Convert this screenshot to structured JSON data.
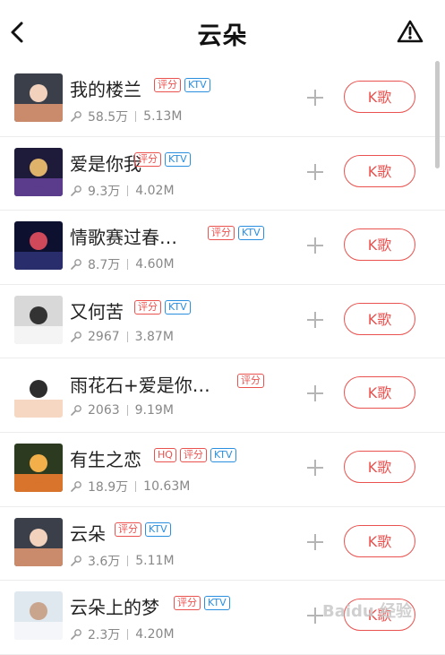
{
  "header": {
    "title": "云朵",
    "back_icon": "chevron-left-icon",
    "report_icon": "warning-triangle-icon"
  },
  "buttons": {
    "sing_label": "K歌"
  },
  "songs": [
    {
      "title": "我的楼兰",
      "tags": [
        "评分",
        "KTV"
      ],
      "plays": "58.5万",
      "size": "5.13M"
    },
    {
      "title": "爱是你我",
      "tags": [
        "评分",
        "KTV"
      ],
      "plays": "9.3万",
      "size": "4.02M"
    },
    {
      "title": "情歌赛过春…",
      "tags": [
        "评分",
        "KTV"
      ],
      "plays": "8.7万",
      "size": "4.60M"
    },
    {
      "title": "又何苦",
      "tags": [
        "评分",
        "KTV"
      ],
      "plays": "2967",
      "size": "3.87M"
    },
    {
      "title": "雨花石+爱是你…",
      "tags": [
        "评分"
      ],
      "plays": "2063",
      "size": "9.19M"
    },
    {
      "title": "有生之恋",
      "tags": [
        "HQ",
        "评分",
        "KTV"
      ],
      "plays": "18.9万",
      "size": "10.63M"
    },
    {
      "title": "云朵",
      "tags": [
        "评分",
        "KTV"
      ],
      "plays": "3.6万",
      "size": "5.11M"
    },
    {
      "title": "云朵上的梦",
      "tags": [
        "评分",
        "KTV"
      ],
      "plays": "2.3万",
      "size": "4.20M"
    }
  ],
  "watermark": "Baidu 经验",
  "colors": {
    "accent": "#e9524f",
    "ktv": "#2b8fe0",
    "meta": "#888888"
  }
}
